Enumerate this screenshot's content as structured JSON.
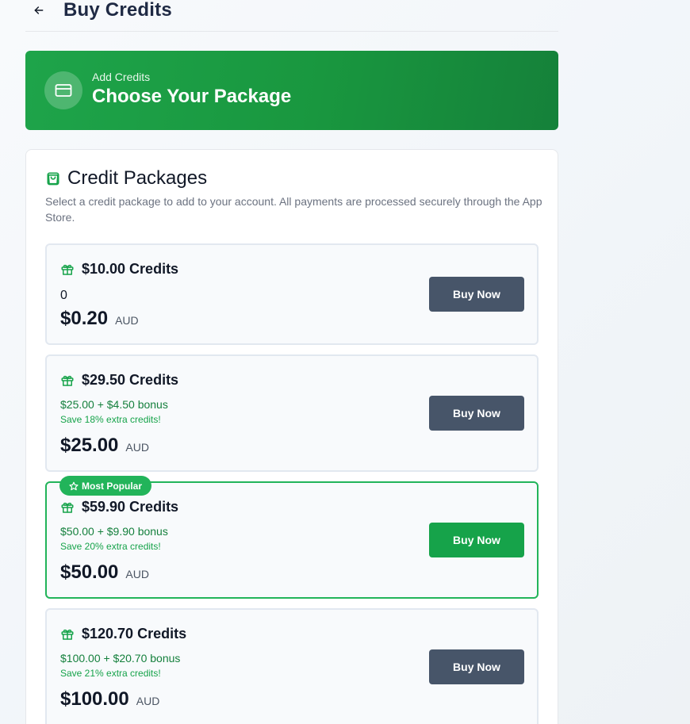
{
  "header": {
    "title": "Buy Credits",
    "back_icon": "arrow-left-icon"
  },
  "hero": {
    "subtitle": "Add Credits",
    "title": "Choose Your Package",
    "icon": "credit-card-icon"
  },
  "packages_card": {
    "title": "Credit Packages",
    "icon": "shopping-bag-icon",
    "description": "Select a credit package to add to your account. All payments are processed securely through the App Store."
  },
  "packages": [
    {
      "name": "$10.00 Credits",
      "detail": "0",
      "bonus": "",
      "save": "",
      "price": "$0.20",
      "currency": "AUD",
      "button": "Buy Now",
      "popular": false
    },
    {
      "name": "$29.50 Credits",
      "detail": "",
      "bonus": "$25.00 + $4.50 bonus",
      "save": "Save 18% extra credits!",
      "price": "$25.00",
      "currency": "AUD",
      "button": "Buy Now",
      "popular": false
    },
    {
      "name": "$59.90 Credits",
      "detail": "",
      "bonus": "$50.00 + $9.90 bonus",
      "save": "Save 20% extra credits!",
      "price": "$50.00",
      "currency": "AUD",
      "button": "Buy Now",
      "popular": true
    },
    {
      "name": "$120.70 Credits",
      "detail": "",
      "bonus": "$100.00 + $20.70 bonus",
      "save": "Save 21% extra credits!",
      "price": "$100.00",
      "currency": "AUD",
      "button": "Buy Now",
      "popular": false
    }
  ],
  "popular_badge": {
    "label": "Most Popular",
    "icon": "star-icon"
  },
  "colors": {
    "brand_green": "#16a34a",
    "button_slate": "#475569",
    "bonus_green": "#15803d"
  }
}
